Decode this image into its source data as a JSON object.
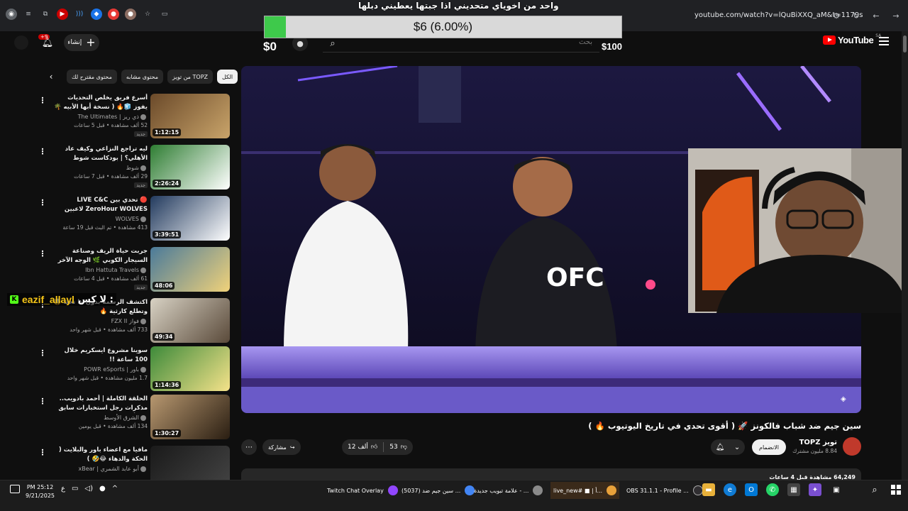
{
  "browser": {
    "url": "youtube.com/watch?v=lQuBiXXQ_aM&t=1179s"
  },
  "donation_goal": {
    "title": "واحد من اخوياي متحديني اذا جبتها يعطيني دبلها",
    "progress_label": "$6 (6.00%)",
    "progress_fraction": 0.06,
    "min_label": "$0",
    "max_label": "$100"
  },
  "header": {
    "search_placeholder": "بحث",
    "logo_text": "YouTube",
    "logo_region": "SA",
    "create_label": "إنشاء",
    "notif_count": "+9"
  },
  "chips": [
    "الكل",
    "من تويز TOPZ",
    "محتوى مشابه",
    "محتوى مقترح لك"
  ],
  "recommendations": [
    {
      "title": "أسرع فريق يخلص التحديات يفوز 🧊🔥 ( نسخة أبها الأبيه 🌴 )",
      "channel": "ذي ريز | The Ultimates",
      "meta": "52 ألف مشاهدة • قبل 5 ساعات",
      "badge": "جديد",
      "duration": "1:12:15"
    },
    {
      "title": "ليه تراجع النزاعي وكيف عاد الأهلي؟ | بودكاست شوط",
      "channel": "شوط",
      "meta": "29 ألف مشاهدة • قبل 7 ساعات",
      "badge": "جديد",
      "duration": "2:26:24"
    },
    {
      "title": "🔴 تحدي بين LIVE C&C ZeroHour WOLVES لاعبين كلان الذئاب ...",
      "channel": "WOLVES",
      "meta": "413 مشاهدة • تم البث قبل 19 ساعة",
      "badge": "",
      "duration": "3:39:51"
    },
    {
      "title": "جربت حياة الريف وصناعة السيجار الكوبي 🌿 الوجه الآخر لكوبا cu",
      "channel": "Ibn Hattuta Travels",
      "meta": "61 ألف مشاهدة • قبل 4 ساعات",
      "badge": "جديد",
      "duration": "48:06"
    },
    {
      "title": "اكتشف الرسمة بدون ما تحك 🤯 وتطلع كارثية 🔥",
      "channel": "فواز FZX II",
      "meta": "733 ألف مشاهدة • قبل شهر واحد",
      "badge": "",
      "duration": "49:34"
    },
    {
      "title": "سوينا مشروع ايسكريم خلال 100 ساعة !!",
      "channel": "باور | POWR eSports",
      "meta": "1.7 مليون مشاهدة • قبل شهر واحد",
      "badge": "",
      "duration": "1:14:36"
    },
    {
      "title": "الحلقة الكاملة | أحمد بادويب.. مذكرات رجل استخبارات سابق في أفغانستان",
      "channel": "الشرق الأوسط",
      "meta": "134 ألف مشاهدة • قبل يومين",
      "badge": "",
      "duration": "1:30:27"
    },
    {
      "title": "مافيا مع اعضاء باور والبلايت ( الحكة والدهاء 😂🤣 )",
      "channel": "أبو عابد الشمري | xBear",
      "meta": "",
      "badge": "",
      "duration": ""
    }
  ],
  "chat": {
    "username": "eazif_allayl",
    "message": "لا كس :"
  },
  "video": {
    "title": "سين جيم ضد شباب فالكونز 🚀 ( أقوى تحدي في تاريخ اليوتيوب 🔥 )",
    "channel_name": "تويز TOPZ",
    "subscribers": "8.84 مليون مشترك",
    "join_label": "الانضمام",
    "likes": "12 ألف",
    "dislikes": "53",
    "share_label": "مشاركة",
    "description_preview": "64,249 مشاهدة قبل 4 ساعات"
  },
  "taskbar": {
    "time": "PM 25:12",
    "date": "9/21/2025",
    "lang": "ع",
    "tasks": [
      {
        "label": "Twitch Chat Overlay"
      },
      {
        "label": "(5037) سين جيم ضد ..."
      },
      {
        "label": "علامة تبويب جديدة - ..."
      },
      {
        "label": "live_new# ■ | أ..."
      },
      {
        "label": "OBS 31.1.1 - Profile ..."
      }
    ]
  },
  "colors": {
    "goal_fill": "#3ec94b",
    "yt_red": "#ff0000",
    "chat_user": "#f5c518",
    "kick_green": "#53fc18"
  }
}
